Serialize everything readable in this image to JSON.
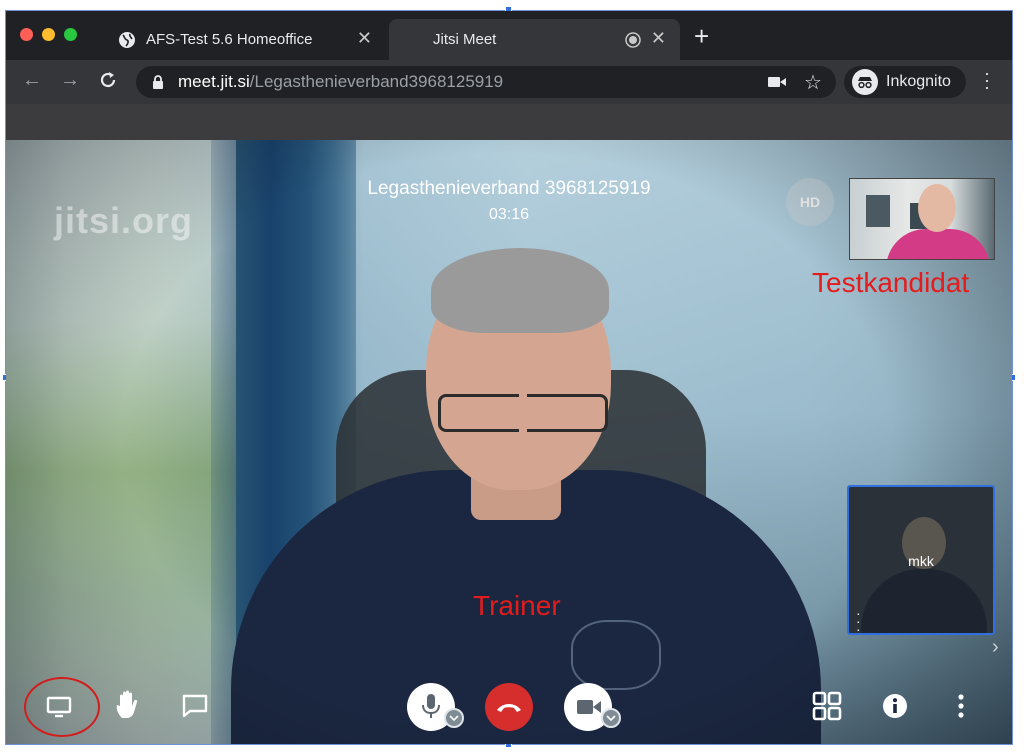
{
  "browser": {
    "tabs": [
      {
        "label": "AFS-Test 5.6 Homeoffice"
      },
      {
        "label": "Jitsi Meet"
      }
    ],
    "address": {
      "domain": "meet.jit.si",
      "path": "/Legasthenieverband3968125919"
    },
    "profile_label": "Inkognito"
  },
  "meeting": {
    "watermark": "jitsi.org",
    "room_title": "Legasthenieverband 3968125919",
    "timer": "03:16",
    "quality_badge": "HD",
    "remote_label": "Testkandidat",
    "speaker_label": "Trainer",
    "local_name": "mkk"
  },
  "icons": {
    "screen_share": "desktop-icon",
    "raise_hand": "hand-icon",
    "chat": "chat-icon",
    "mic": "microphone-icon",
    "hangup": "phone-hangup-icon",
    "camera": "camera-icon",
    "tile_view": "tile-grid-icon",
    "info": "info-icon",
    "more": "more-vertical-icon"
  },
  "colors": {
    "hangup": "#d62d2d",
    "annotation": "#e41c1c",
    "selection": "#2f6fe0"
  }
}
